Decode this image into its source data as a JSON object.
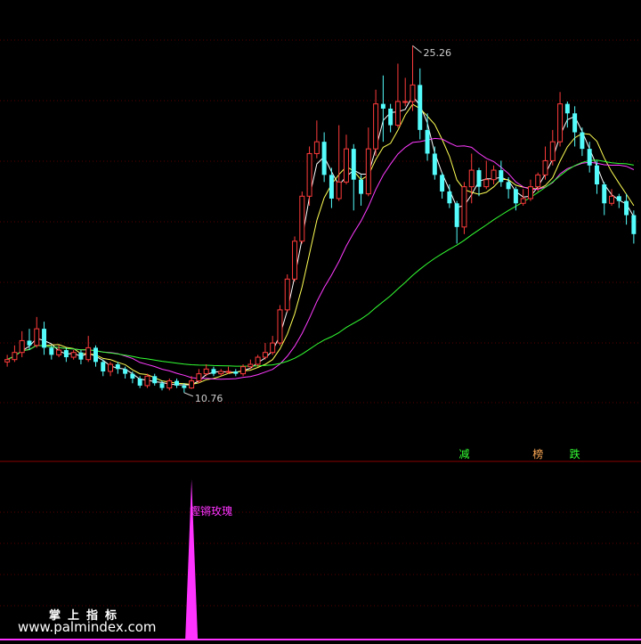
{
  "chart_data": {
    "type": "candlestick",
    "price_high_label": "25.26",
    "price_low_label": "10.76",
    "ylim": [
      8,
      27
    ],
    "grid": "horizontal dotted",
    "colors": {
      "up": "#ff3b3b",
      "down": "#54fcfc",
      "ma_short": "#ffffff",
      "ma_mid": "#ffff55",
      "ma_long": "#ff3bff",
      "ma_longest": "#33ff33",
      "signal": "#ff33ff"
    },
    "candles": [
      [
        11.9,
        12.0,
        12.2,
        11.7
      ],
      [
        12.0,
        12.3,
        12.6,
        11.9
      ],
      [
        12.3,
        12.8,
        13.2,
        12.1
      ],
      [
        12.8,
        12.6,
        13.3,
        12.4
      ],
      [
        12.6,
        13.3,
        13.8,
        12.5
      ],
      [
        13.3,
        12.5,
        13.6,
        12.2
      ],
      [
        12.5,
        12.2,
        12.6,
        12.0
      ],
      [
        12.2,
        12.4,
        12.6,
        12.1
      ],
      [
        12.4,
        12.1,
        12.5,
        11.9
      ],
      [
        12.1,
        12.3,
        12.4,
        12.0
      ],
      [
        12.3,
        12.0,
        12.4,
        11.8
      ],
      [
        12.0,
        12.5,
        13.0,
        11.9
      ],
      [
        12.5,
        11.9,
        12.6,
        11.7
      ],
      [
        11.9,
        11.5,
        12.0,
        11.3
      ],
      [
        11.5,
        11.8,
        11.9,
        11.3
      ],
      [
        11.8,
        11.6,
        11.9,
        11.4
      ],
      [
        11.6,
        11.4,
        11.7,
        11.2
      ],
      [
        11.4,
        11.2,
        11.5,
        11.0
      ],
      [
        11.2,
        10.9,
        11.3,
        10.8
      ],
      [
        10.9,
        11.3,
        11.4,
        10.8
      ],
      [
        11.3,
        11.0,
        11.4,
        10.9
      ],
      [
        11.0,
        10.8,
        11.1,
        10.7
      ],
      [
        10.8,
        11.1,
        11.2,
        10.7
      ],
      [
        11.1,
        10.9,
        11.2,
        10.8
      ],
      [
        10.9,
        10.8,
        11.0,
        10.6
      ],
      [
        10.8,
        11.1,
        11.3,
        10.76
      ],
      [
        11.1,
        11.4,
        11.6,
        11.0
      ],
      [
        11.4,
        11.6,
        11.8,
        11.3
      ],
      [
        11.6,
        11.4,
        11.7,
        11.3
      ],
      [
        11.4,
        11.5,
        11.6,
        11.3
      ],
      [
        11.5,
        11.5,
        11.7,
        11.4
      ],
      [
        11.5,
        11.4,
        11.6,
        11.3
      ],
      [
        11.4,
        11.7,
        11.8,
        11.3
      ],
      [
        11.7,
        11.8,
        12.0,
        11.6
      ],
      [
        11.8,
        12.1,
        12.2,
        11.7
      ],
      [
        12.1,
        12.3,
        12.7,
        12.0
      ],
      [
        12.3,
        12.7,
        13.0,
        12.2
      ],
      [
        12.7,
        14.1,
        14.3,
        12.6
      ],
      [
        14.1,
        15.4,
        15.6,
        14.0
      ],
      [
        15.4,
        17.0,
        17.2,
        15.3
      ],
      [
        17.0,
        18.9,
        19.1,
        16.9
      ],
      [
        18.9,
        20.7,
        21.0,
        18.5
      ],
      [
        20.7,
        21.2,
        22.1,
        20.5
      ],
      [
        21.2,
        19.8,
        21.6,
        19.5
      ],
      [
        19.8,
        18.8,
        20.1,
        18.4
      ],
      [
        18.8,
        19.5,
        21.9,
        18.7
      ],
      [
        19.5,
        20.9,
        21.5,
        19.4
      ],
      [
        20.9,
        19.6,
        21.1,
        18.3
      ],
      [
        19.6,
        19.0,
        19.8,
        18.5
      ],
      [
        19.0,
        20.9,
        21.8,
        18.9
      ],
      [
        20.9,
        22.8,
        23.4,
        20.6
      ],
      [
        22.8,
        22.6,
        24.0,
        21.2
      ],
      [
        22.6,
        21.9,
        22.8,
        21.6
      ],
      [
        21.9,
        22.9,
        24.5,
        21.8
      ],
      [
        22.9,
        22.9,
        23.9,
        22.7
      ],
      [
        22.9,
        23.6,
        25.26,
        22.5
      ],
      [
        23.6,
        21.7,
        24.3,
        21.3
      ],
      [
        21.7,
        20.7,
        22.4,
        20.4
      ],
      [
        20.7,
        19.8,
        21.0,
        19.6
      ],
      [
        19.8,
        19.1,
        19.9,
        18.8
      ],
      [
        19.1,
        18.6,
        19.4,
        18.4
      ],
      [
        18.6,
        17.6,
        18.7,
        16.9
      ],
      [
        17.6,
        19.3,
        19.5,
        17.3
      ],
      [
        19.3,
        20.0,
        20.7,
        18.6
      ],
      [
        20.0,
        19.3,
        20.1,
        18.9
      ],
      [
        19.3,
        19.6,
        20.4,
        19.2
      ],
      [
        19.6,
        20.0,
        20.2,
        19.4
      ],
      [
        20.0,
        19.5,
        20.4,
        19.3
      ],
      [
        19.5,
        19.2,
        19.7,
        18.8
      ],
      [
        19.2,
        18.6,
        19.3,
        18.3
      ],
      [
        18.6,
        18.8,
        19.2,
        18.5
      ],
      [
        18.8,
        19.3,
        19.6,
        18.7
      ],
      [
        19.3,
        19.8,
        19.9,
        19.1
      ],
      [
        19.8,
        20.4,
        21.0,
        19.6
      ],
      [
        20.4,
        21.2,
        21.7,
        20.2
      ],
      [
        21.2,
        22.8,
        23.3,
        21.0
      ],
      [
        22.8,
        22.4,
        22.9,
        21.8
      ],
      [
        22.4,
        21.6,
        22.7,
        21.0
      ],
      [
        21.6,
        20.9,
        21.8,
        20.6
      ],
      [
        20.9,
        20.2,
        21.2,
        19.9
      ],
      [
        20.2,
        19.4,
        20.4,
        19.0
      ],
      [
        19.4,
        18.6,
        19.5,
        18.1
      ],
      [
        18.6,
        18.9,
        19.2,
        18.5
      ],
      [
        18.9,
        18.7,
        19.0,
        18.4
      ],
      [
        18.7,
        18.1,
        19.0,
        17.7
      ],
      [
        18.1,
        17.3,
        18.3,
        16.9
      ]
    ],
    "signal_text": "鏗锵玫瑰",
    "signal_index": 25,
    "markers": [
      {
        "text": "减",
        "index": 62,
        "color": "#33ff33"
      },
      {
        "text": "榜",
        "index": 72,
        "color": "#ffaa55"
      },
      {
        "text": "跌",
        "index": 77,
        "color": "#33ff33"
      }
    ]
  },
  "watermark": {
    "cn": "掌上指标",
    "url": "www.palmindex.com"
  }
}
